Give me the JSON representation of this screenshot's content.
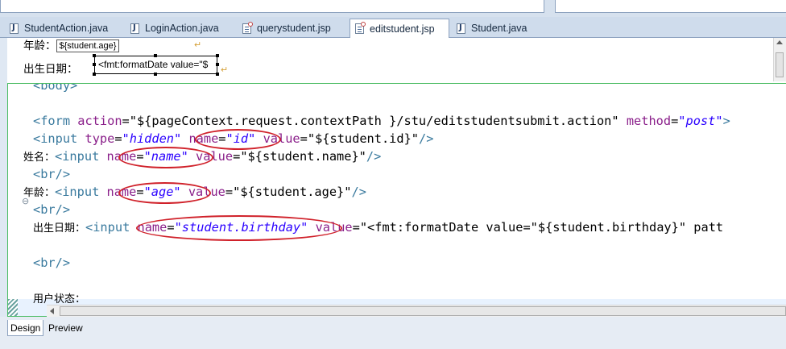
{
  "editor_tabs": [
    {
      "label": "StudentAction.java",
      "icon": "java-file-icon",
      "active": false
    },
    {
      "label": "LoginAction.java",
      "icon": "java-file-icon",
      "active": false
    },
    {
      "label": "querystudent.jsp",
      "icon": "jsp-file-icon",
      "active": false
    },
    {
      "label": "editstudent.jsp",
      "icon": "jsp-file-icon",
      "active": true
    },
    {
      "label": "Student.java",
      "icon": "java-file-icon",
      "active": false
    }
  ],
  "design_view": {
    "age_label": "年龄：",
    "age_value": "${student.age}",
    "birthday_label": "出生日期：",
    "birthday_value": "<fmt:formatDate value=\"$"
  },
  "source_view": {
    "body_partial": "<body>",
    "form": {
      "open": "<form",
      "action_attr": "action",
      "action_value": "\"${pageContext.request.contextPath }/stu/editstudentsubmit.action\"",
      "method_attr": "method",
      "method_value": "\"post\"",
      "tail": ">"
    },
    "hidden_input": {
      "open": "<input",
      "type_attr": "type",
      "type_value": "\"hidden\"",
      "name_attr": "name",
      "name_value": "\"id\"",
      "value_attr": "value",
      "value_value": "\"${student.id}\"",
      "close": "/>"
    },
    "name_line": {
      "label": "姓名：",
      "open": "<input",
      "name_attr": "name",
      "name_value": "\"name\"",
      "value_attr": "value",
      "value_value": "\"${student.name}\"",
      "close": "/>"
    },
    "br": "<br/>",
    "age_line": {
      "label": "年龄：",
      "open": "<input",
      "name_attr": "name",
      "name_value": "\"age\"",
      "value_attr": "value",
      "value_value": "\"${student.age}\"",
      "close": "/>"
    },
    "birthday_line": {
      "label": "出生日期：",
      "open": "<input",
      "name_attr": "name",
      "name_value": "\"student.birthday\"",
      "value_attr": "value",
      "value_value": "\"<fmt:formatDate value=\"${student.birthday}\" patt"
    },
    "status_label": "用户状态："
  },
  "bottom_tabs": [
    {
      "label": "Design",
      "active": true
    },
    {
      "label": "Preview",
      "active": false
    }
  ],
  "colors": {
    "tag": "#3a7a9e",
    "attribute": "#8a1f8a",
    "value": "#2a00ff",
    "annotation": "#d0212a",
    "source_border": "#4cbd64"
  }
}
